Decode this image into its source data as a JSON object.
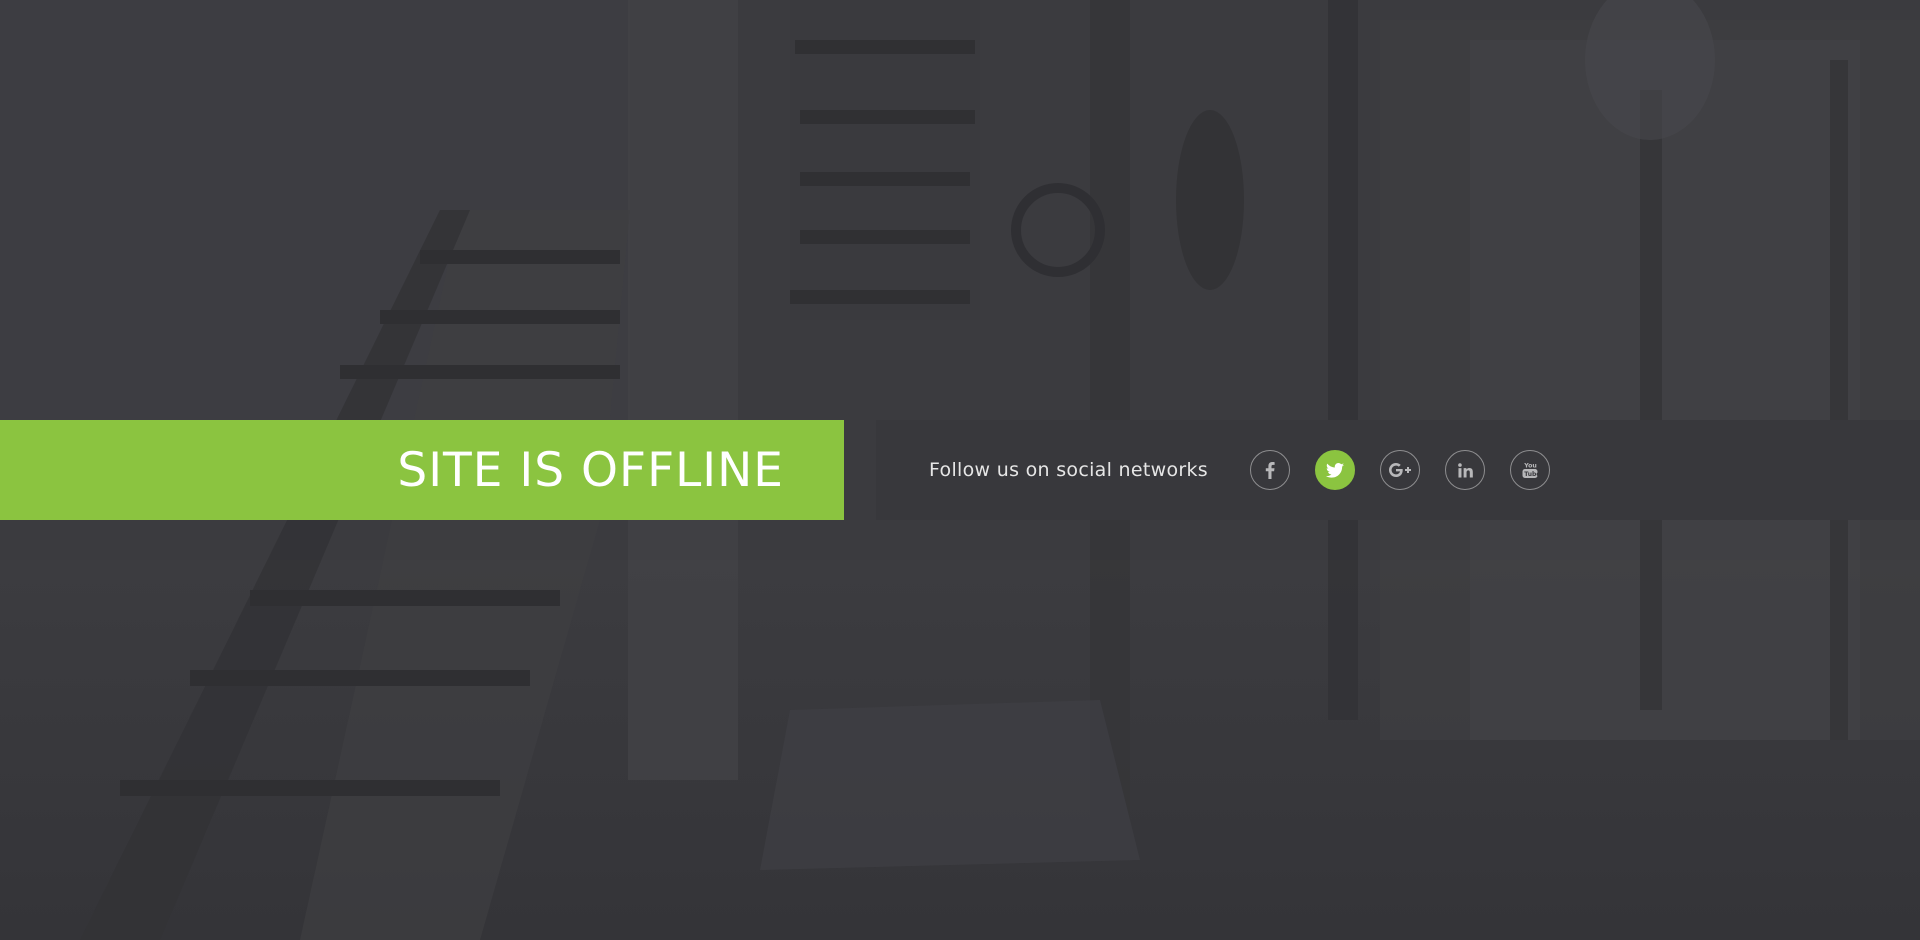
{
  "banner": {
    "title": "SITE IS OFFLINE"
  },
  "social": {
    "follow_text": "Follow us on social networks",
    "networks": [
      {
        "name": "facebook",
        "icon": "facebook-icon",
        "active": false
      },
      {
        "name": "twitter",
        "icon": "twitter-icon",
        "active": true
      },
      {
        "name": "google-plus",
        "icon": "google-plus-icon",
        "active": false
      },
      {
        "name": "linkedin",
        "icon": "linkedin-icon",
        "active": false
      },
      {
        "name": "youtube",
        "icon": "youtube-icon",
        "active": false
      }
    ]
  },
  "colors": {
    "accent": "#8bc440",
    "background": "#3a3a3e",
    "bar": "#38383c",
    "text": "#e6e6e6"
  }
}
